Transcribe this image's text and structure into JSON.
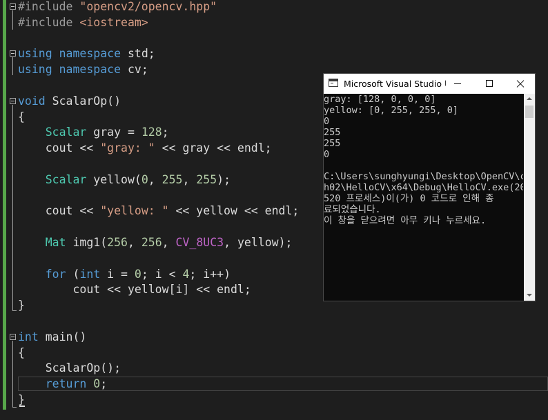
{
  "editor": {
    "lines": [
      [
        {
          "t": "#include ",
          "c": "pp"
        },
        {
          "t": "\"opencv2/opencv.hpp\"",
          "c": "str"
        }
      ],
      [
        {
          "t": "#include ",
          "c": "pp"
        },
        {
          "t": "<iostream>",
          "c": "str"
        }
      ],
      [],
      [
        {
          "t": "using",
          "c": "kw"
        },
        {
          "t": " "
        },
        {
          "t": "namespace",
          "c": "kw"
        },
        {
          "t": " std;"
        }
      ],
      [
        {
          "t": "using",
          "c": "kw"
        },
        {
          "t": " "
        },
        {
          "t": "namespace",
          "c": "kw"
        },
        {
          "t": " cv;"
        }
      ],
      [],
      [
        {
          "t": "void",
          "c": "kw"
        },
        {
          "t": " ScalarOp()"
        }
      ],
      [
        {
          "t": "{"
        }
      ],
      [
        {
          "t": "    "
        },
        {
          "t": "Scalar",
          "c": "type"
        },
        {
          "t": " gray = "
        },
        {
          "t": "128",
          "c": "num"
        },
        {
          "t": ";"
        }
      ],
      [
        {
          "t": "    cout << "
        },
        {
          "t": "\"gray: \"",
          "c": "str"
        },
        {
          "t": " << gray << endl;"
        }
      ],
      [],
      [
        {
          "t": "    "
        },
        {
          "t": "Scalar",
          "c": "type"
        },
        {
          "t": " yellow("
        },
        {
          "t": "0",
          "c": "num"
        },
        {
          "t": ", "
        },
        {
          "t": "255",
          "c": "num"
        },
        {
          "t": ", "
        },
        {
          "t": "255",
          "c": "num"
        },
        {
          "t": ");"
        }
      ],
      [],
      [
        {
          "t": "    cout << "
        },
        {
          "t": "\"yellow: \"",
          "c": "str"
        },
        {
          "t": " << yellow << endl;"
        }
      ],
      [],
      [
        {
          "t": "    "
        },
        {
          "t": "Mat",
          "c": "type"
        },
        {
          "t": " img1("
        },
        {
          "t": "256",
          "c": "num"
        },
        {
          "t": ", "
        },
        {
          "t": "256",
          "c": "num"
        },
        {
          "t": ", "
        },
        {
          "t": "CV_8UC3",
          "c": "mac"
        },
        {
          "t": ", yellow);"
        }
      ],
      [],
      [
        {
          "t": "    "
        },
        {
          "t": "for",
          "c": "kw"
        },
        {
          "t": " ("
        },
        {
          "t": "int",
          "c": "kw"
        },
        {
          "t": " i = "
        },
        {
          "t": "0",
          "c": "num"
        },
        {
          "t": "; i < "
        },
        {
          "t": "4",
          "c": "num"
        },
        {
          "t": "; i++)"
        }
      ],
      [
        {
          "t": "        cout << yellow[i] << endl;"
        }
      ],
      [
        {
          "t": "}"
        }
      ],
      [],
      [
        {
          "t": "int",
          "c": "kw"
        },
        {
          "t": " main()"
        }
      ],
      [
        {
          "t": "{"
        }
      ],
      [
        {
          "t": "    ScalarOp();"
        }
      ],
      [
        {
          "t": "    "
        },
        {
          "t": "return",
          "c": "kw"
        },
        {
          "t": " "
        },
        {
          "t": "0",
          "c": "num"
        },
        {
          "t": ";"
        }
      ],
      [
        {
          "t": "}"
        }
      ]
    ]
  },
  "console": {
    "title": "Microsoft Visual Studio 디버그 콘솔",
    "lines": [
      "gray: [128, 0, 0, 0]",
      "yellow: [0, 255, 255, 0]",
      "0",
      "255",
      "255",
      "0",
      "",
      "C:\\Users\\sunghyungi\\Desktop\\OpenCV\\c",
      "h02\\HelloCV\\x64\\Debug\\HelloCV.exe(20",
      "520 프로세스)이(가) 0 코드로 인해 종",
      "료되었습니다.",
      "이 창을 닫으려면 아무 키나 누르세요."
    ],
    "icons": {
      "app": "console-app-icon",
      "minimize": "minimize-icon",
      "maximize": "maximize-icon",
      "close": "close-icon"
    }
  }
}
